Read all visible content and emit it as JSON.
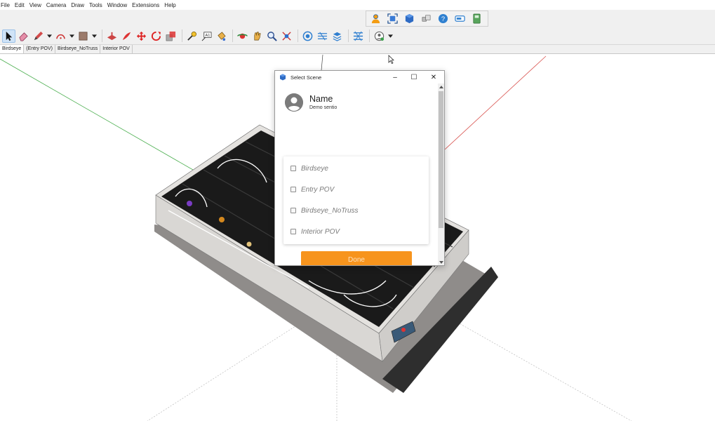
{
  "menu": [
    "File",
    "Edit",
    "View",
    "Camera",
    "Draw",
    "Tools",
    "Window",
    "Extensions",
    "Help"
  ],
  "top_toolbar": {
    "icons": [
      "user-icon",
      "zoom-extents-icon",
      "3d-warehouse-icon",
      "components-icon",
      "help-icon",
      "layout-icon",
      "style-builder-icon"
    ]
  },
  "main_toolbar": {
    "icons": [
      "select-icon",
      "eraser-icon",
      "pencil-icon",
      "arc-icon",
      "shape-icon",
      "push-pull-icon",
      "follow-me-icon",
      "move-icon",
      "rotate-icon",
      "scale-icon",
      "tape-measure-icon",
      "text-icon",
      "paint-bucket-icon",
      "orbit-icon",
      "pan-icon",
      "zoom-icon",
      "zoom-extents-icon",
      "warehouse-icon",
      "sandbox-icon",
      "layers-icon",
      "scenes-icon",
      "profile-icon"
    ]
  },
  "scene_tabs": [
    "Birdseye",
    "(Entry POV)",
    "Birdseye_NoTruss",
    "Interior POV"
  ],
  "selected_scene_tab": 0,
  "dialog": {
    "title": "Select Scene",
    "minimize_glyph": "–",
    "maximize_glyph": "☐",
    "close_glyph": "✕",
    "profile_name": "Name",
    "profile_subtitle": "Demo sentio",
    "scenes": [
      {
        "label": "Birdseye",
        "checked": false
      },
      {
        "label": "Entry POV",
        "checked": false
      },
      {
        "label": "Birdseye_NoTruss",
        "checked": false
      },
      {
        "label": "Interior POV",
        "checked": false
      }
    ],
    "done_label": "Done"
  },
  "colors": {
    "accent_orange": "#f7941d",
    "axis_green": "#4caf50",
    "axis_red": "#d9534f",
    "axis_blue": "#3b6fd9"
  }
}
